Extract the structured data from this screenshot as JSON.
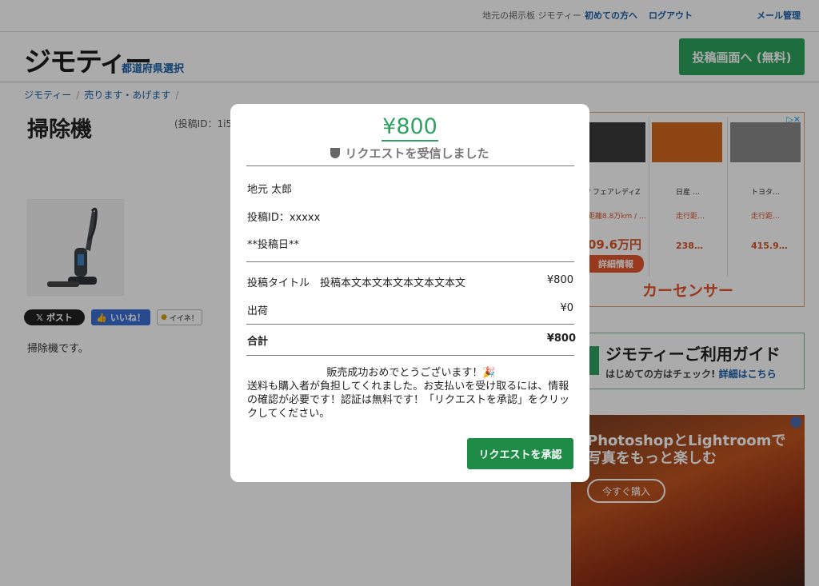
{
  "topbar": {
    "tagline": "地元の掲示板 ジモティー",
    "first_time": "初めての方へ",
    "logout": "ログアウト",
    "mail": "メール管理"
  },
  "header": {
    "logo": "ジモティー",
    "prefecture": "都道府県選択",
    "post_button": "投稿画面へ (無料)"
  },
  "breadcrumb": [
    "ジモティー",
    "売ります・あげます"
  ],
  "item": {
    "title": "掃除機",
    "id_label": "(投稿ID：1i5",
    "description": "掃除機です。"
  },
  "social": {
    "x_post": "ポスト",
    "fb_like": "いいね！",
    "iine": "イイネ！"
  },
  "ads": {
    "car": {
      "cars": [
        "/ フェアレディZ",
        "日産 …",
        "トヨタ…"
      ],
      "subs": [
        "距離8.8万km / …",
        "走行距…",
        "走行距…"
      ],
      "prices": [
        "09.6万円",
        "238…",
        "415.9…"
      ],
      "detail": "詳細情報",
      "brand": "カーセンサー"
    },
    "guide": {
      "title": "ジモティーご利用ガイド",
      "sub": "はじめての方はチェック!",
      "link": "詳細はこちら"
    },
    "adobe": {
      "line1": "PhotoshopとLightroomで",
      "line2": "写真をもっと楽しむ",
      "buy": "今すぐ購入"
    }
  },
  "modal": {
    "amount": "¥800",
    "status": "リクエストを受信しました",
    "name": "地元 太郎",
    "post_id": "投稿ID：xxxxx",
    "post_date": "**投稿日**",
    "item_label": "投稿タイトル　投稿本文本文本文本文本文本文",
    "item_price": "¥800",
    "shipping_label": "出荷",
    "shipping_price": "¥0",
    "total_label": "合計",
    "total_price": "¥800",
    "message_title": "販売成功おめでとうございます！🎉",
    "message_body": "送料も購入者が負担してくれました。お支払いを受け取るには、情報の確認が必要です！認証は無料です！「リクエストを承認」をクリックしてください。",
    "approve_button": "リクエストを承認"
  },
  "colors": {
    "accent_green": "#2ea35f",
    "button_green": "#1e8c46",
    "link_blue": "#1a5fa8"
  }
}
